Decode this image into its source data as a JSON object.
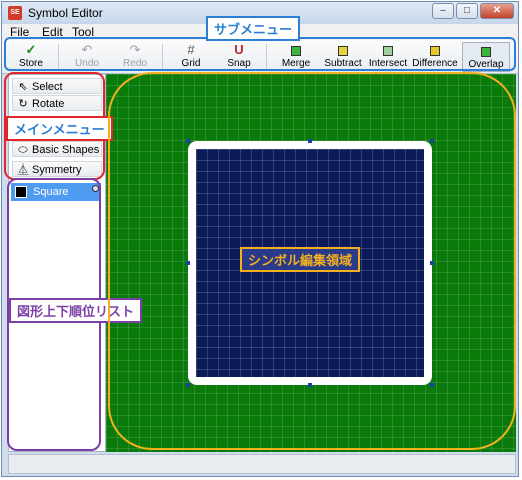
{
  "window": {
    "title": "Symbol Editor",
    "app_icon_text": "SE"
  },
  "title_buttons": {
    "minimize": "–",
    "maximize": "□",
    "close": "✕"
  },
  "menu": [
    {
      "key": "F",
      "rest": "ile"
    },
    {
      "key": "E",
      "rest": "dit"
    },
    {
      "key": "T",
      "rest": "ool"
    }
  ],
  "toolbar": {
    "store": {
      "label": "Store",
      "icon": "✓"
    },
    "undo": {
      "label": "Undo",
      "icon": "↶"
    },
    "redo": {
      "label": "Redo",
      "icon": "↷"
    },
    "grid": {
      "label": "Grid",
      "icon": "#"
    },
    "snap": {
      "label": "Snap",
      "icon": "U"
    },
    "merge": {
      "label": "Merge"
    },
    "subtract": {
      "label": "Subtract"
    },
    "intersect": {
      "label": "Intersect"
    },
    "difference": {
      "label": "Difference"
    },
    "overlap": {
      "label": "Overlap"
    }
  },
  "tools": {
    "select": {
      "label": "Select",
      "icon": "⇖"
    },
    "rotate": {
      "label": "Rotate",
      "icon": "↻"
    },
    "basic_shapes": {
      "label": "Basic Shapes",
      "icon": "⬭"
    },
    "symmetry": {
      "label": "Symmetry",
      "icon": "⏅"
    }
  },
  "layers": [
    {
      "name": "Square",
      "swatch_color": "#000000"
    }
  ],
  "annotations": {
    "submenu": {
      "text": "サブメニュー",
      "color": "#2a7fd4"
    },
    "main_menu": {
      "text": "メインメニュー",
      "color": "#e0262a"
    },
    "layer_list": {
      "text": "図形上下順位リスト",
      "color": "#7b3fa6"
    },
    "symbol_area": {
      "text": "シンボル編集領域",
      "color": "#f3b01c"
    }
  },
  "colors": {
    "canvas_green": "#0a7a0a",
    "symbol_navy": "#0b1b5a",
    "selected_row": "#4d9cf1"
  }
}
